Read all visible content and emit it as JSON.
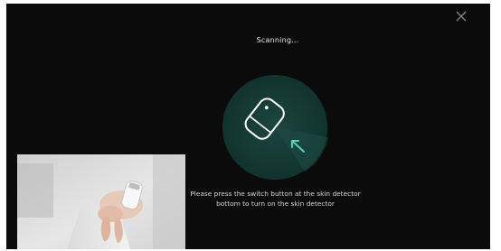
{
  "dialog": {
    "title": "Scanning...",
    "instruction": "Please press the switch button at the skin detector bottom to turn on the skin detector",
    "close_icon": "close-icon"
  },
  "illustration": {
    "device_icon": "skin-detector-icon",
    "arrow_icon": "arrow-up-left-icon",
    "accent_color": "#5ad1b0",
    "circle_color": "#163a34"
  },
  "video": {
    "label": "tutorial-video-preview"
  }
}
